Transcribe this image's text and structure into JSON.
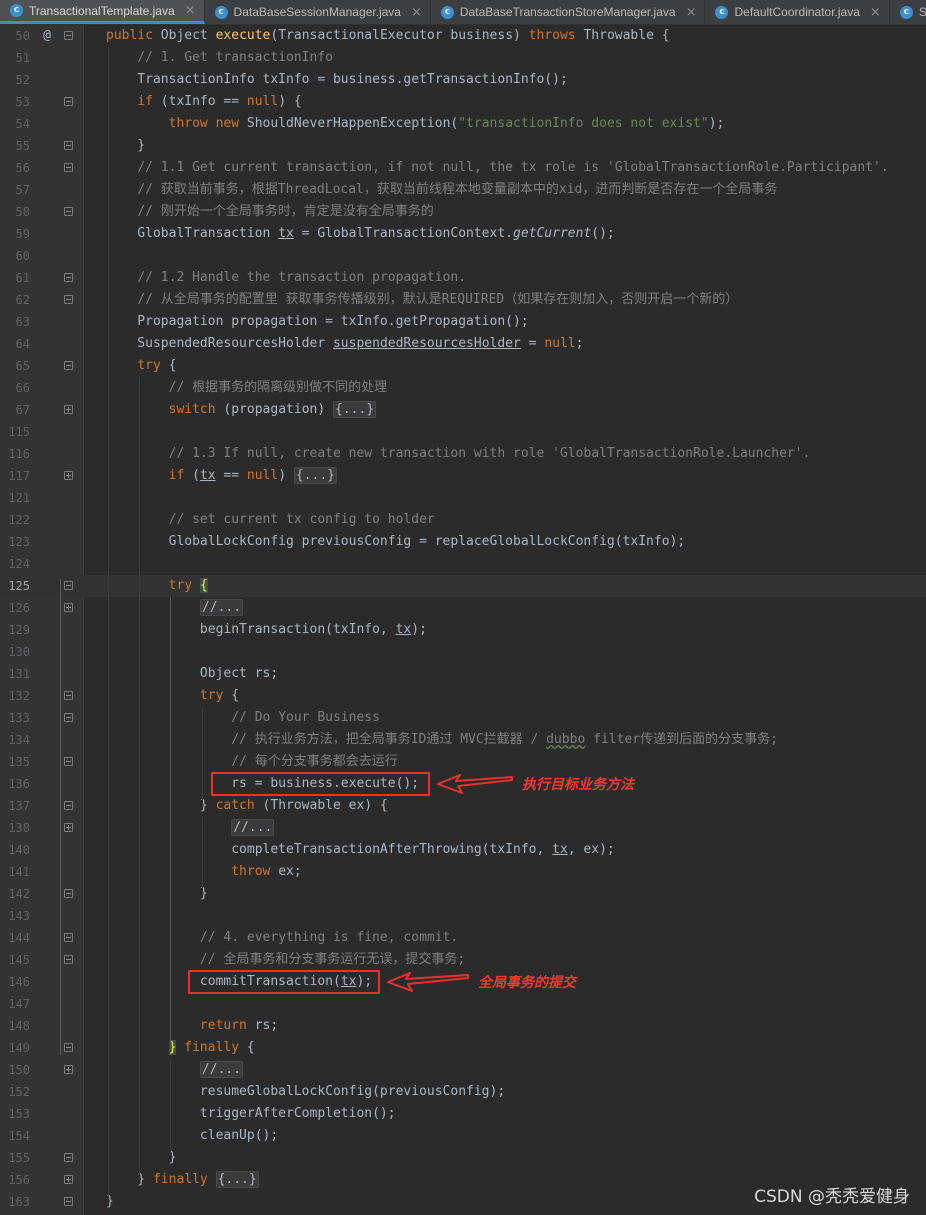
{
  "tabs": [
    {
      "label": "TransactionalTemplate.java",
      "icon": "java-class-icon",
      "active": true
    },
    {
      "label": "DataBaseSessionManager.java",
      "icon": "java-class-icon",
      "active": false
    },
    {
      "label": "DataBaseTransactionStoreManager.java",
      "icon": "java-class-icon",
      "active": false
    },
    {
      "label": "DefaultCoordinator.java",
      "icon": "java-class-icon",
      "active": false
    },
    {
      "label": "Server.java",
      "icon": "java-class-icon",
      "active": false
    }
  ],
  "tab_close_glyph": "×",
  "tab_icon_glyph": "c",
  "gutter_override_mark": "@",
  "current_line": "125",
  "lines": [
    {
      "n": "50",
      "mark": "@",
      "fold": "exp",
      "code": [
        [
          "kw",
          "public "
        ],
        [
          "",
          "Object "
        ],
        [
          "fn",
          "execute"
        ],
        [
          "",
          "(TransactionalExecutor business) "
        ],
        [
          "kw",
          "throws "
        ],
        [
          "",
          "Throwable {"
        ]
      ]
    },
    {
      "n": "51",
      "fold": "",
      "code": [
        [
          "",
          "    "
        ],
        [
          "cm",
          "// 1. Get transactionInfo"
        ]
      ]
    },
    {
      "n": "52",
      "fold": "",
      "code": [
        [
          "",
          "    TransactionInfo txInfo = business.getTransactionInfo();"
        ]
      ]
    },
    {
      "n": "53",
      "fold": "exp",
      "code": [
        [
          "",
          "    "
        ],
        [
          "kw",
          "if "
        ],
        [
          "",
          "(txInfo == "
        ],
        [
          "kw",
          "null"
        ],
        [
          "",
          ") {"
        ]
      ]
    },
    {
      "n": "54",
      "fold": "",
      "code": [
        [
          "",
          "        "
        ],
        [
          "kw",
          "throw new "
        ],
        [
          "",
          "ShouldNeverHappenException("
        ],
        [
          "st",
          "\"transactionInfo does not exist\""
        ],
        [
          "",
          ");"
        ]
      ]
    },
    {
      "n": "55",
      "fold": "exp",
      "code": [
        [
          "",
          "    }"
        ]
      ]
    },
    {
      "n": "56",
      "fold": "exp",
      "code": [
        [
          "",
          "    "
        ],
        [
          "cm",
          "// 1.1 Get current transaction, if not null, the tx role is 'GlobalTransactionRole.Participant'."
        ]
      ]
    },
    {
      "n": "57",
      "fold": "",
      "code": [
        [
          "",
          "    "
        ],
        [
          "cm",
          "// 获取当前事务，根据ThreadLocal，获取当前线程本地变量副本中的xid，进而判断是否存在一个全局事务"
        ]
      ]
    },
    {
      "n": "58",
      "fold": "exp",
      "code": [
        [
          "",
          "    "
        ],
        [
          "cm",
          "// 刚开始一个全局事务时，肯定是没有全局事务的"
        ]
      ]
    },
    {
      "n": "59",
      "fold": "",
      "code": [
        [
          "",
          "    GlobalTransaction "
        ],
        [
          "ul",
          "tx"
        ],
        [
          "",
          " = GlobalTransactionContext."
        ],
        [
          "it",
          "getCurrent"
        ],
        [
          "",
          "();"
        ]
      ]
    },
    {
      "n": "60",
      "fold": "",
      "code": [
        [
          "",
          ""
        ]
      ]
    },
    {
      "n": "61",
      "fold": "exp",
      "code": [
        [
          "",
          "    "
        ],
        [
          "cm",
          "// 1.2 Handle the transaction propagation."
        ]
      ]
    },
    {
      "n": "62",
      "fold": "exp",
      "code": [
        [
          "",
          "    "
        ],
        [
          "cm",
          "// 从全局事务的配置里 获取事务传播级别，默认是REQUIRED（如果存在则加入，否则开启一个新的）"
        ]
      ]
    },
    {
      "n": "63",
      "fold": "",
      "code": [
        [
          "",
          "    Propagation propagation = txInfo.getPropagation();"
        ]
      ]
    },
    {
      "n": "64",
      "fold": "",
      "code": [
        [
          "",
          "    SuspendedResourcesHolder "
        ],
        [
          "ul",
          "suspendedResourcesHolder"
        ],
        [
          "",
          " = "
        ],
        [
          "kw",
          "null"
        ],
        [
          "",
          ";"
        ]
      ]
    },
    {
      "n": "65",
      "fold": "exp",
      "code": [
        [
          "",
          "    "
        ],
        [
          "kw",
          "try "
        ],
        [
          "",
          "{"
        ]
      ]
    },
    {
      "n": "66",
      "fold": "",
      "code": [
        [
          "",
          "        "
        ],
        [
          "cm",
          "// 根据事务的隔离级别做不同的处理"
        ]
      ]
    },
    {
      "n": "67",
      "fold": "col",
      "code": [
        [
          "",
          "        "
        ],
        [
          "kw",
          "switch "
        ],
        [
          "",
          "(propagation) "
        ],
        [
          "fold-ph",
          "{...}"
        ]
      ]
    },
    {
      "n": "115",
      "fold": "",
      "code": [
        [
          "",
          ""
        ]
      ]
    },
    {
      "n": "116",
      "fold": "",
      "code": [
        [
          "",
          "        "
        ],
        [
          "cm",
          "// 1.3 If null, create new transaction with role 'GlobalTransactionRole.Launcher'."
        ]
      ]
    },
    {
      "n": "117",
      "fold": "col",
      "code": [
        [
          "",
          "        "
        ],
        [
          "kw",
          "if "
        ],
        [
          "",
          "("
        ],
        [
          "ul",
          "tx"
        ],
        [
          "",
          " == "
        ],
        [
          "kw",
          "null"
        ],
        [
          "",
          ") "
        ],
        [
          "fold-ph",
          "{...}"
        ]
      ]
    },
    {
      "n": "121",
      "fold": "",
      "code": [
        [
          "",
          ""
        ]
      ]
    },
    {
      "n": "122",
      "fold": "",
      "code": [
        [
          "",
          "        "
        ],
        [
          "cm",
          "// set current tx config to holder"
        ]
      ]
    },
    {
      "n": "123",
      "fold": "",
      "code": [
        [
          "",
          "        GlobalLockConfig previousConfig = replaceGlobalLockConfig(txInfo);"
        ]
      ]
    },
    {
      "n": "124",
      "fold": "",
      "code": [
        [
          "",
          ""
        ]
      ]
    },
    {
      "n": "125",
      "fold": "exp",
      "code": [
        [
          "",
          "        "
        ],
        [
          "kw",
          "try "
        ],
        [
          "brace-hl",
          "{"
        ]
      ]
    },
    {
      "n": "126",
      "fold": "col",
      "code": [
        [
          "",
          "            "
        ],
        [
          "fold-ph",
          "//..."
        ]
      ]
    },
    {
      "n": "129",
      "fold": "",
      "code": [
        [
          "",
          "            beginTransaction(txInfo, "
        ],
        [
          "ul",
          "tx"
        ],
        [
          "",
          ");"
        ]
      ]
    },
    {
      "n": "130",
      "fold": "",
      "code": [
        [
          "",
          ""
        ]
      ]
    },
    {
      "n": "131",
      "fold": "",
      "code": [
        [
          "",
          "            Object rs;"
        ]
      ]
    },
    {
      "n": "132",
      "fold": "exp",
      "code": [
        [
          "",
          "            "
        ],
        [
          "kw",
          "try "
        ],
        [
          "",
          "{"
        ]
      ]
    },
    {
      "n": "133",
      "fold": "exp",
      "code": [
        [
          "",
          "                "
        ],
        [
          "cm",
          "// Do Your Business"
        ]
      ]
    },
    {
      "n": "134",
      "fold": "",
      "code": [
        [
          "",
          "                "
        ],
        [
          "cm",
          "// 执行业务方法，把全局事务ID通过 MVC拦截器 / "
        ],
        [
          "cm squig",
          "dubbo"
        ],
        [
          "cm",
          " filter传递到后面的分支事务;"
        ]
      ]
    },
    {
      "n": "135",
      "fold": "exp",
      "code": [
        [
          "",
          "                "
        ],
        [
          "cm",
          "// 每个分支事务都会去运行"
        ]
      ]
    },
    {
      "n": "136",
      "fold": "",
      "code": [
        [
          "",
          "                rs = business.execute();"
        ]
      ]
    },
    {
      "n": "137",
      "fold": "exp",
      "code": [
        [
          "",
          "            } "
        ],
        [
          "kw",
          "catch "
        ],
        [
          "",
          "(Throwable ex) {"
        ]
      ]
    },
    {
      "n": "138",
      "fold": "col",
      "code": [
        [
          "",
          "                "
        ],
        [
          "fold-ph",
          "//..."
        ]
      ]
    },
    {
      "n": "140",
      "fold": "",
      "code": [
        [
          "",
          "                completeTransactionAfterThrowing(txInfo, "
        ],
        [
          "ul",
          "tx"
        ],
        [
          "",
          ", ex);"
        ]
      ]
    },
    {
      "n": "141",
      "fold": "",
      "code": [
        [
          "",
          "                "
        ],
        [
          "kw",
          "throw "
        ],
        [
          "",
          "ex;"
        ]
      ]
    },
    {
      "n": "142",
      "fold": "exp",
      "code": [
        [
          "",
          "            }"
        ]
      ]
    },
    {
      "n": "143",
      "fold": "",
      "code": [
        [
          "",
          ""
        ]
      ]
    },
    {
      "n": "144",
      "fold": "exp",
      "code": [
        [
          "",
          "            "
        ],
        [
          "cm",
          "// 4. everything is fine, commit."
        ]
      ]
    },
    {
      "n": "145",
      "fold": "exp",
      "code": [
        [
          "",
          "            "
        ],
        [
          "cm",
          "// 全局事务和分支事务运行无误，提交事务;"
        ]
      ]
    },
    {
      "n": "146",
      "fold": "",
      "code": [
        [
          "",
          "            commitTransaction("
        ],
        [
          "ul",
          "tx"
        ],
        [
          "",
          ");"
        ]
      ]
    },
    {
      "n": "147",
      "fold": "",
      "code": [
        [
          "",
          ""
        ]
      ]
    },
    {
      "n": "148",
      "fold": "",
      "code": [
        [
          "",
          "            "
        ],
        [
          "kw",
          "return "
        ],
        [
          "",
          "rs;"
        ]
      ]
    },
    {
      "n": "149",
      "fold": "exp",
      "code": [
        [
          "",
          "        "
        ],
        [
          "brace-hl",
          "}"
        ],
        [
          "",
          " "
        ],
        [
          "kw",
          "finally "
        ],
        [
          "",
          "{"
        ]
      ]
    },
    {
      "n": "150",
      "fold": "col",
      "code": [
        [
          "",
          "            "
        ],
        [
          "fold-ph",
          "//..."
        ]
      ]
    },
    {
      "n": "152",
      "fold": "",
      "code": [
        [
          "",
          "            resumeGlobalLockConfig(previousConfig);"
        ]
      ]
    },
    {
      "n": "153",
      "fold": "",
      "code": [
        [
          "",
          "            triggerAfterCompletion();"
        ]
      ]
    },
    {
      "n": "154",
      "fold": "",
      "code": [
        [
          "",
          "            cleanUp();"
        ]
      ]
    },
    {
      "n": "155",
      "fold": "exp",
      "code": [
        [
          "",
          "        }"
        ]
      ]
    },
    {
      "n": "156",
      "fold": "col",
      "code": [
        [
          "",
          "    } "
        ],
        [
          "kw",
          "finally "
        ],
        [
          "fold-ph",
          "{...}"
        ]
      ]
    },
    {
      "n": "163",
      "fold": "exp",
      "code": [
        [
          "",
          "}"
        ]
      ]
    }
  ],
  "annotations": [
    {
      "label": "执行目标业务方法",
      "target_line": "136"
    },
    {
      "label": "全局事务的提交",
      "target_line": "146"
    }
  ],
  "colors": {
    "background": "#2b2b2b",
    "keyword": "#cc7832",
    "method": "#ffc66d",
    "comment": "#808080",
    "string": "#6a8759",
    "annotation_red": "#e8312b"
  },
  "watermark": "CSDN @秃秃爱健身"
}
